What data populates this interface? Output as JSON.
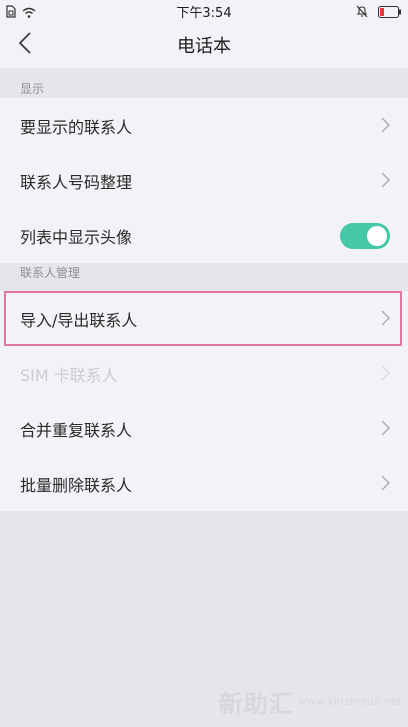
{
  "status_bar": {
    "time": "下午3:54",
    "icons": [
      "sim-icon",
      "wifi-icon",
      "mute-bell-icon",
      "battery-low-icon"
    ],
    "battery_color": "#e03b3b"
  },
  "header": {
    "title": "电话本",
    "back_icon": "chevron-left-icon"
  },
  "sections": {
    "display": {
      "header": "显示",
      "items": [
        {
          "label": "要显示的联系人"
        },
        {
          "label": "联系人号码整理"
        },
        {
          "label": "列表中显示头像",
          "toggle": true
        }
      ]
    },
    "manage": {
      "header": "联系人管理",
      "items": [
        {
          "label": "导入/导出联系人",
          "highlighted": true
        },
        {
          "label": "SIM 卡联系人",
          "disabled": true
        },
        {
          "label": "合并重复联系人"
        },
        {
          "label": "批量删除联系人"
        }
      ]
    }
  },
  "colors": {
    "accent_toggle": "#45c8a7",
    "highlight_border": "#e0789c",
    "background": "#e6e5ea",
    "card": "#f3f2f6"
  },
  "watermark": {
    "logo": "新助汇",
    "url": "www.xinzhuhui.net"
  }
}
